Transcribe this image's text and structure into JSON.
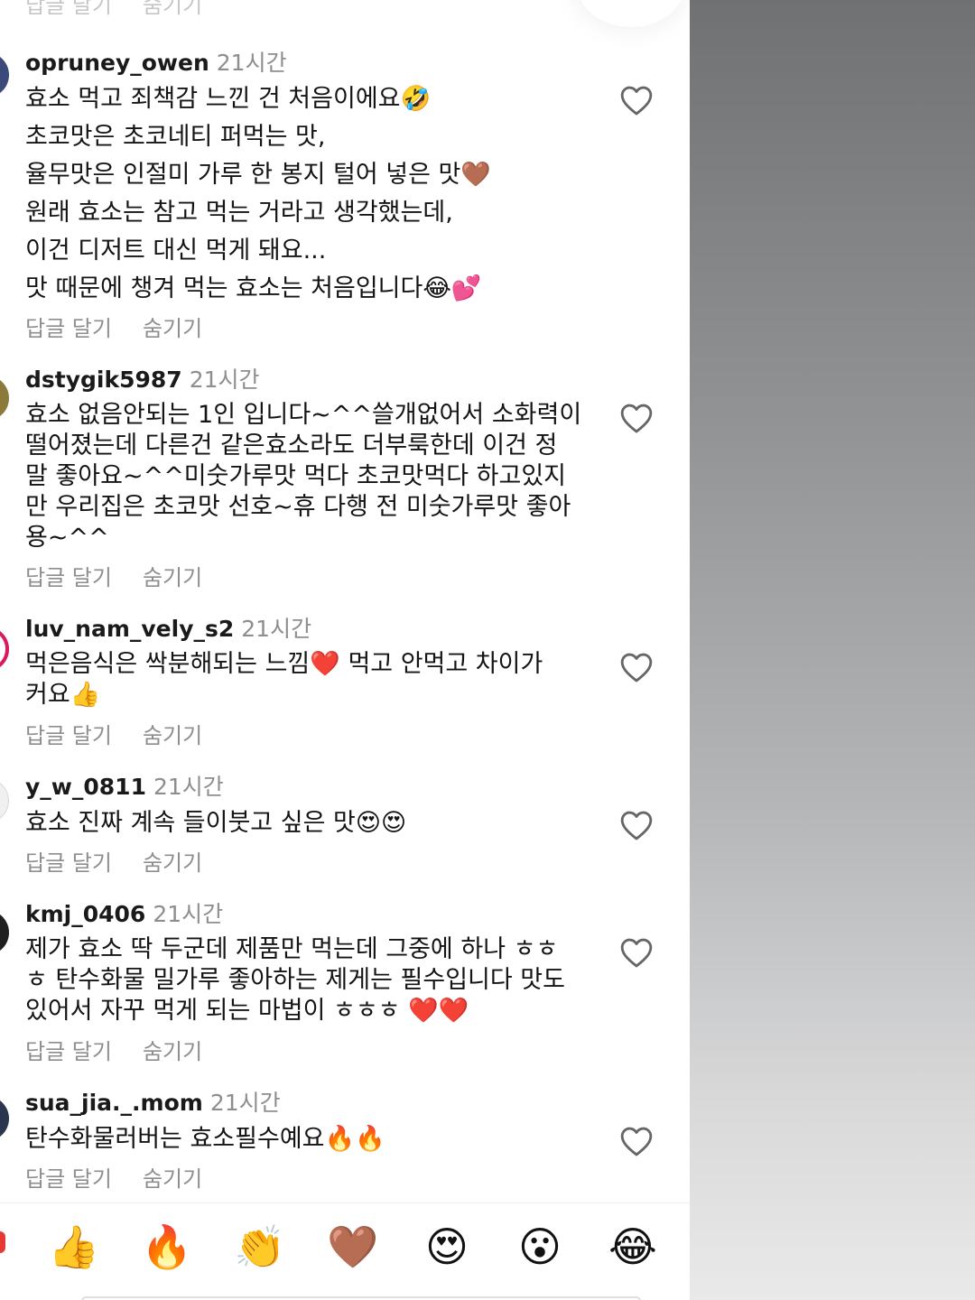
{
  "top_faded": {
    "reply": "답글 달기",
    "hide": "숨기기"
  },
  "comments": [
    {
      "username": "opruney_owen",
      "time": "21시간",
      "text": "효소 먹고 죄책감 느낀 건 처음이에요🤣\n초코맛은 초코네티 퍼먹는 맛,\n율무맛은 인절미 가루 한 봉지 털어 넣은 맛🤎\n원래 효소는 참고 먹는 거라고 생각했는데,\n이건 디저트 대신 먹게 돼요...\n맛 때문에 챙겨 먹는 효소는 처음입니다😂💕",
      "reply": "답글 달기",
      "hide": "숨기기"
    },
    {
      "username": "dstygik5987",
      "time": "21시간",
      "text": "효소 없음안되는 1인 입니다~^^쓸개없어서 소화력이\n떨어졌는데 다른건 같은효소라도 더부룩한데 이건 정\n말 좋아요~^^미숫가루맛 먹다 초코맛먹다 하고있지\n만 우리집은 초코맛 선호~휴 다행 전 미숫가루맛 좋아\n용~^^",
      "reply": "답글 달기",
      "hide": "숨기기"
    },
    {
      "username": "luv_nam_vely_s2",
      "time": "21시간",
      "text": "먹은음식은 싹분해되는 느낌❤️ 먹고 안먹고 차이가\n커요👍",
      "reply": "답글 달기",
      "hide": "숨기기"
    },
    {
      "username": "y_w_0811",
      "time": "21시간",
      "text": "효소 진짜 계속 들이붓고 싶은 맛😍😍",
      "reply": "답글 달기",
      "hide": "숨기기"
    },
    {
      "username": "kmj_0406",
      "time": "21시간",
      "text": "제가 효소 딱 두군데 제품만 먹는데 그중에 하나 ㅎㅎ\nㅎ 탄수화물 밀가루  좋아하는 제게는 필수입니다 맛도\n있어서 자꾸 먹게 되는 마법이 ㅎㅎㅎ ❤️❤️",
      "reply": "답글 달기",
      "hide": "숨기기"
    },
    {
      "username": "sua_jia._.mom",
      "time": "21시간",
      "text": "탄수화물러버는 효소필수예요🔥🔥",
      "reply": "답글 달기",
      "hide": "숨기기"
    }
  ],
  "emoji_bar": [
    "👍",
    "🔥",
    "👏",
    "🤎",
    "😍",
    "😮",
    "😂"
  ],
  "icons": {
    "like": "heart-outline-icon"
  },
  "colors": {
    "muted_text": "#8e8e8e",
    "avatar_1": "#3b4a7a",
    "avatar_2": "#8b7a3c",
    "avatar_3": "#d81b60",
    "avatar_4": "#d9d9d9",
    "avatar_5": "#1f1f1f",
    "avatar_6": "#2a3550"
  }
}
